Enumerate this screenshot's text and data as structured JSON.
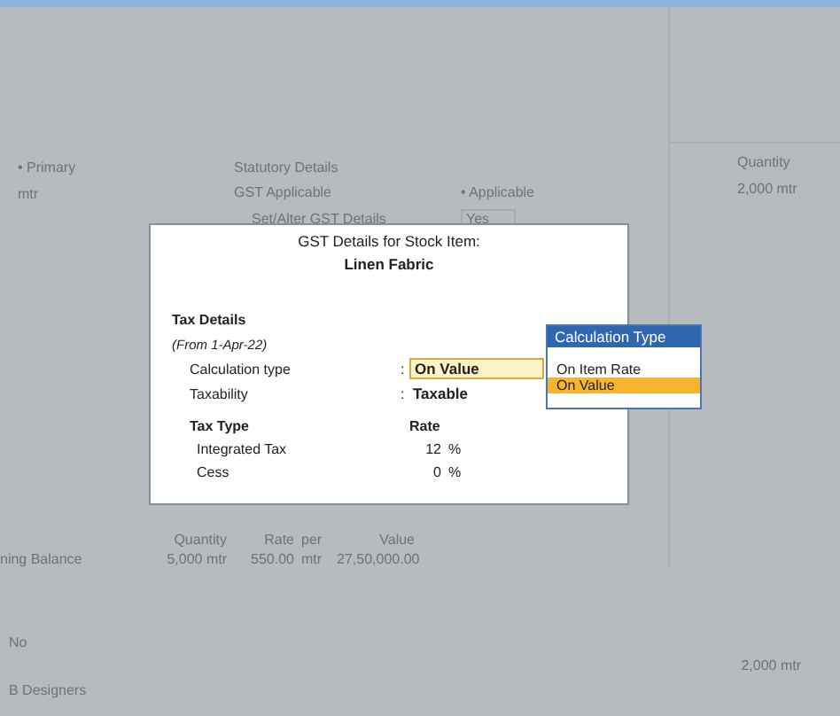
{
  "background": {
    "left_header": "• Primary",
    "left_value": "mtr",
    "statutory": {
      "heading": "Statutory Details",
      "gst_label": "GST Applicable",
      "gst_value": "• Applicable",
      "alter_label": "Set/Alter GST Details",
      "alter_value": "Yes"
    },
    "right_panel": {
      "column": "Quantity",
      "value": "2,000 mtr"
    },
    "opening": {
      "columns": [
        "Quantity",
        "Rate",
        "per",
        "Value"
      ],
      "label": "ning Balance",
      "cells": [
        "5,000 mtr",
        "550.00",
        "mtr",
        "27,50,000.00"
      ]
    },
    "footer": {
      "value_1": "No",
      "value_2": "B Designers",
      "total": "2,000 mtr"
    }
  },
  "dialog": {
    "title": "GST Details for Stock Item:",
    "item": "Linen Fabric",
    "section": "Tax Details",
    "period": "(From 1-Apr-22)",
    "fields": [
      {
        "label": "Calculation type",
        "separator": ":",
        "value": "On Value",
        "kind": "input"
      },
      {
        "label": "Taxability",
        "separator": ":",
        "value": "Taxable",
        "kind": "text"
      }
    ],
    "tax_columns": [
      "Tax Type",
      "Rate"
    ],
    "taxes": [
      {
        "name": "Integrated Tax",
        "rate": "12",
        "unit": "%"
      },
      {
        "name": "Cess",
        "rate": "0",
        "unit": "%"
      }
    ]
  },
  "popup": {
    "title": "Calculation Type",
    "options": [
      {
        "label": "On Item Rate",
        "selected": false
      },
      {
        "label": "On Value",
        "selected": true
      }
    ]
  }
}
